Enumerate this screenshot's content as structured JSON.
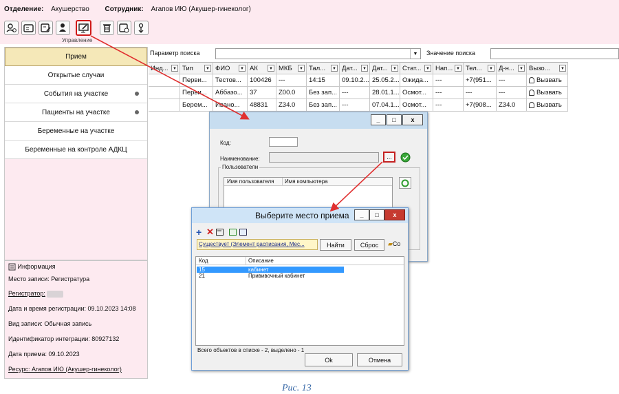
{
  "header": {
    "department_label": "Отделение:",
    "department_value": "Акушерство",
    "employee_label": "Сотрудник:",
    "employee_value": "Агапов ИЮ (Акушер-гинеколог)",
    "toolbar_caption": "Управление",
    "toolbar_icons": [
      "add-person-icon",
      "card-icon",
      "card-edit-icon",
      "people-icon",
      "monitor-edit-icon",
      "trash-icon",
      "card-x-icon",
      "person-arrow-icon"
    ],
    "selected_color": "#d01818"
  },
  "nav": {
    "items": [
      {
        "label": "Прием"
      },
      {
        "label": "Открытые случаи"
      },
      {
        "label": "События на участке"
      },
      {
        "label": "Пациенты на участке"
      },
      {
        "label": "Беременные на участке"
      },
      {
        "label": "Беременные на контроле АДКЦ"
      }
    ]
  },
  "info": {
    "title": "Информация",
    "place": "Место записи: Регистратура",
    "registrar": "Регистратор:",
    "reg_datetime": "Дата и время регистрации: 09.10.2023 14:08",
    "record_type": "Вид записи: Обычная запись",
    "integration_id": "Идентификатор интеграции: 80927132",
    "visit_date": "Дата приема: 09.10.2023",
    "resource": "Ресурс: Агапов ИЮ (Акушер-гинеколог)"
  },
  "search": {
    "param_label": "Параметр поиска",
    "value_label": "Значение поиска"
  },
  "grid": {
    "columns": [
      "Инд...",
      "Тип",
      "ФИО",
      "АК",
      "МКБ",
      "Тал...",
      "Дат...",
      "Дат...",
      "Стат...",
      "Нап...",
      "Тел...",
      "Д-н...",
      "Вызо..."
    ],
    "rows": [
      [
        "",
        "Перви...",
        "Тестов...",
        "100426",
        "---",
        "14:15",
        "09.10.2...",
        "25.05.2...",
        "Ожида...",
        "---",
        "+7(951...",
        "---",
        "Вызвать"
      ],
      [
        "",
        "Перви...",
        "Аббазо...",
        "37",
        "Z00.0",
        "Без зап...",
        "---",
        "28.01.1...",
        "Осмот...",
        "---",
        "---",
        "---",
        "Вызвать"
      ],
      [
        "",
        "Берем...",
        "Ивано...",
        "48831",
        "Z34.0",
        "Без зап...",
        "---",
        "07.04.1...",
        "Осмот...",
        "---",
        "+7(908...",
        "Z34.0",
        "Вызвать"
      ]
    ]
  },
  "dialog1": {
    "code_label": "Код:",
    "name_label": "Наименование:",
    "browse_label": "...",
    "users_group": "Пользователи",
    "col_user": "Имя пользователя",
    "col_computer": "Имя компьютера"
  },
  "dialog2": {
    "title": "Выберите место приема",
    "filter_text": "Существует (Элемент расписания, Мес...",
    "find_button": "Найти",
    "reset_button": "Сброс",
    "extra_button": "Co",
    "col_code": "Код",
    "col_desc": "Описание",
    "rows": [
      {
        "code": "15",
        "desc": "кабинет"
      },
      {
        "code": "21",
        "desc": "Прививочный кабинет"
      }
    ],
    "status": "Всего объектов в списке - 2, выделено - 1",
    "ok_button": "Ok",
    "cancel_button": "Отмена"
  },
  "figure_caption": "Рис. 13",
  "colors": {
    "header_bg": "#fdeaf0",
    "arrow": "#e03030",
    "selection": "#3399ff"
  }
}
